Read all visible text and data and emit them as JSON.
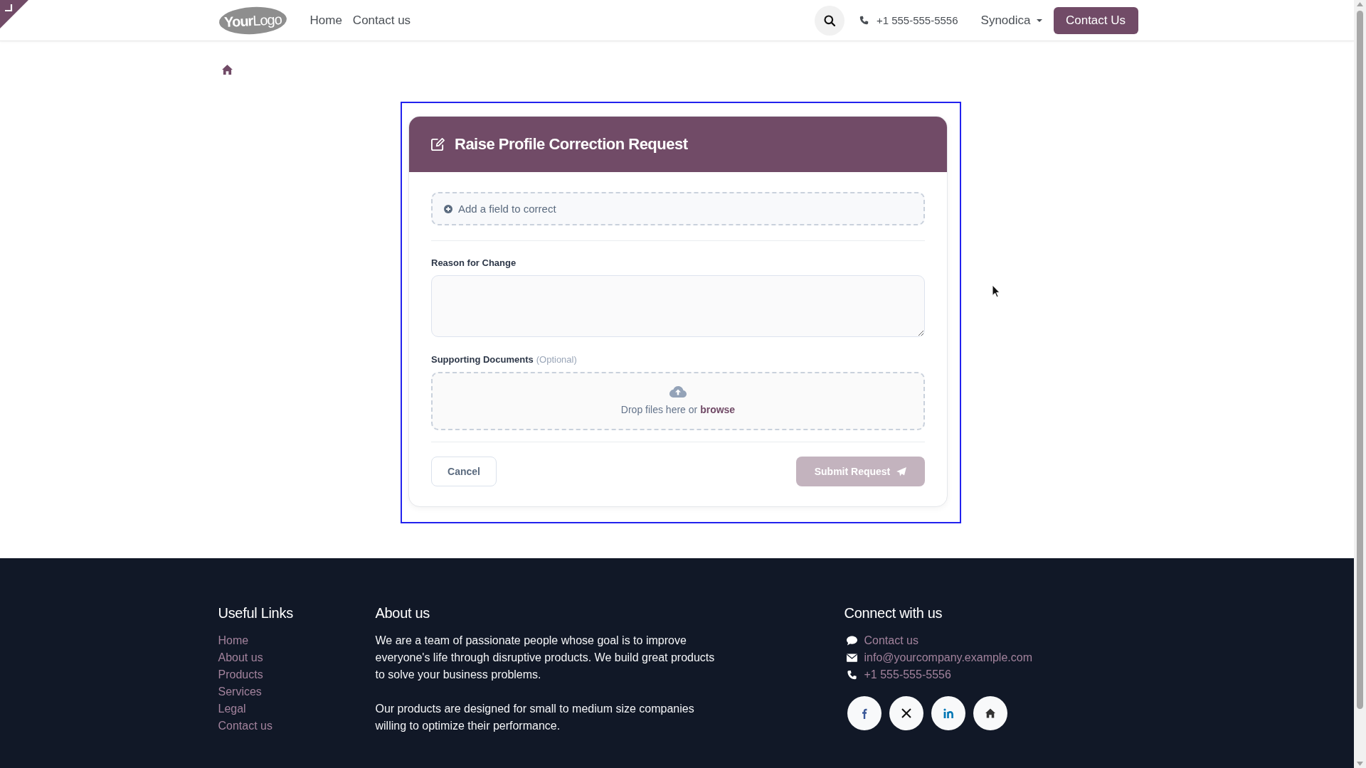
{
  "header": {
    "logo": "**Your**Logo",
    "nav": [
      "Home",
      "Contact us"
    ],
    "phone": "+1 555-555-5556",
    "company_menu": "Synodica",
    "cta_button": "Contact Us"
  },
  "form": {
    "title": "Raise Profile Correction Request",
    "add_field_button": "Add a field to correct",
    "reason": {
      "label": "Reason for Change"
    },
    "documents": {
      "label": "Supporting Documents",
      "hint": "(Optional)",
      "drop_text": "Drop files here or",
      "browse_link": "browse"
    },
    "cancel_button": "Cancel",
    "submit_button": {
      "label": "Submit Request",
      "disabled": true
    }
  },
  "footer": {
    "useful_links": {
      "title": "Useful Links",
      "links": [
        "Home",
        "About us",
        "Products",
        "Services",
        "Legal",
        "Contact us"
      ]
    },
    "about": {
      "title": "About us",
      "paragraphs": [
        "We are a team of passionate people whose goal is to improve everyone's life through disruptive products. We build great products to solve your business problems.",
        "Our products are designed for small to medium size companies willing to optimize their performance."
      ]
    },
    "connect": {
      "title": "Connect with us",
      "items": [
        {
          "kind": "chat",
          "text": "Contact us"
        },
        {
          "kind": "email",
          "text": "info@yourcompany.example.com"
        },
        {
          "kind": "phone",
          "text": "+1 555-555-5556"
        }
      ]
    }
  }
}
